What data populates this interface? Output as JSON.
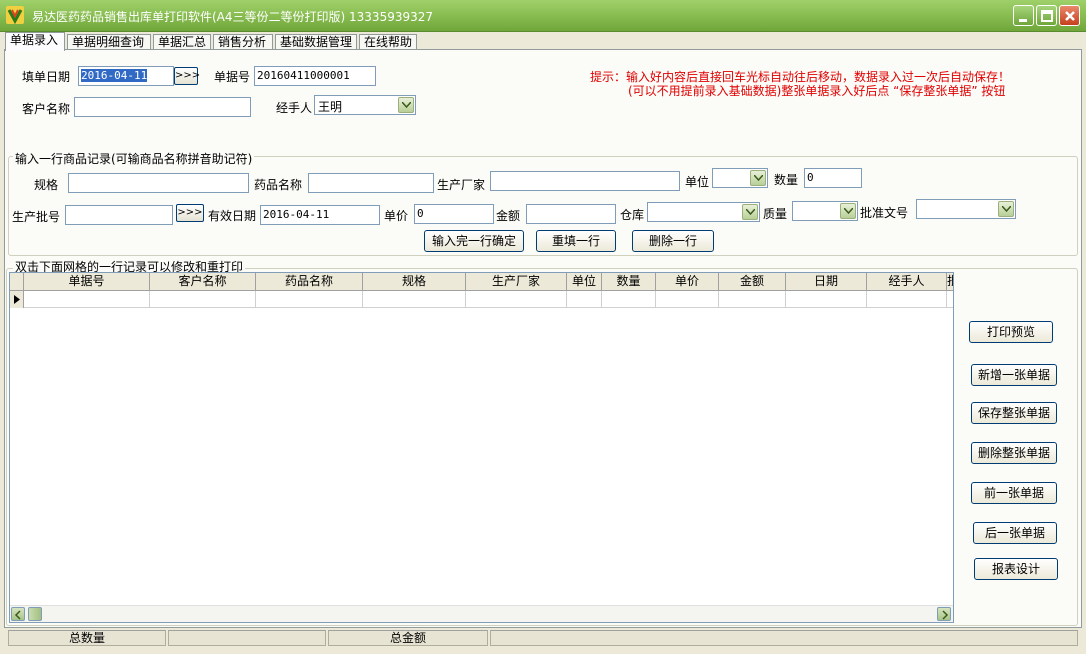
{
  "window": {
    "title": "易达医药药品销售出库单打印软件(A4三等份二等份打印版) 13335939327",
    "icon": "app-logo-icon",
    "controls": [
      "minimize-icon",
      "maximize-icon",
      "close-icon"
    ]
  },
  "tabs": [
    "单据录入",
    "单据明细查询",
    "单据汇总",
    "销售分析",
    "基础数据管理",
    "在线帮助"
  ],
  "header": {
    "date_label": "填单日期",
    "date_value": "2016-04-11",
    "picker_label": ">>>",
    "doc_no_label": "单据号",
    "doc_no_value": "20160411000001",
    "customer_label": "客户名称",
    "customer_value": "",
    "handler_label": "经手人",
    "handler_value": "王明",
    "hint_line1": "提示：输入好内容后直接回车光标自动往后移动，数据录入过一次后自动保存！",
    "hint_line2": "(可以不用提前录入基础数据)整张单据录入好后点 “保存整张单据” 按钮"
  },
  "entry": {
    "group_title": "输入一行商品记录(可输商品名称拼音助记符)",
    "spec_label": "规格",
    "spec_value": "",
    "drug_label": "药品名称",
    "drug_value": "",
    "maker_label": "生产厂家",
    "maker_value": "",
    "unit_label": "单位",
    "unit_value": "",
    "qty_label": "数量",
    "qty_value": "0",
    "batch_label": "生产批号",
    "batch_value": "",
    "batch_picker": ">>>",
    "expiry_label": "有效日期",
    "expiry_value": "2016-04-11",
    "price_label": "单价",
    "price_value": "0",
    "amount_label": "金额",
    "amount_value": "",
    "warehouse_label": "仓库",
    "warehouse_value": "",
    "quality_label": "质量",
    "quality_value": "",
    "approval_label": "批准文号",
    "approval_value": "",
    "confirm_button": "输入完一行确定",
    "refill_button": "重填一行",
    "delete_button": "删除一行"
  },
  "grid": {
    "group_title": "双击下面网格的一行记录可以修改和重打印",
    "columns": [
      "单据号",
      "客户名称",
      "药品名称",
      "规格",
      "生产厂家",
      "单位",
      "数量",
      "单价",
      "金额",
      "日期",
      "经手人",
      "批号"
    ]
  },
  "side_buttons": [
    "打印预览",
    "新增一张单据",
    "保存整张单据",
    "删除整张单据",
    "前一张单据",
    "后一张单据",
    "报表设计"
  ],
  "status": {
    "total_qty_label": "总数量",
    "total_qty_value": "",
    "total_amount_label": "总金额",
    "total_amount_value": ""
  },
  "colors": {
    "title_bar": "#8bbf53",
    "hint_text": "#e00000",
    "selection": "#316ac5"
  }
}
